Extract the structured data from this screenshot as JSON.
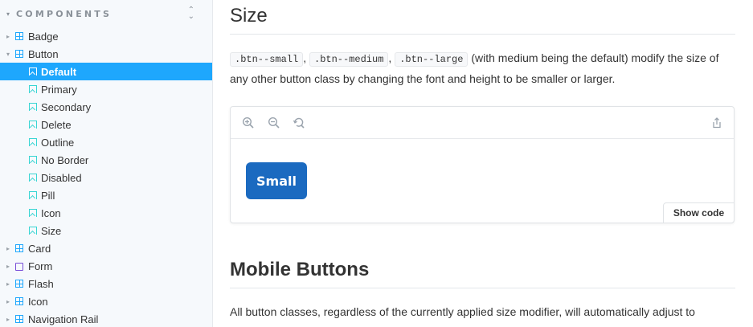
{
  "sidebar": {
    "section_title": "COMPONENTS",
    "items": [
      {
        "label": "Badge",
        "type": "component",
        "expanded": false
      },
      {
        "label": "Button",
        "type": "component",
        "expanded": true
      },
      {
        "label": "Default",
        "type": "story",
        "selected": true
      },
      {
        "label": "Primary",
        "type": "story"
      },
      {
        "label": "Secondary",
        "type": "story"
      },
      {
        "label": "Delete",
        "type": "story"
      },
      {
        "label": "Outline",
        "type": "story"
      },
      {
        "label": "No Border",
        "type": "story"
      },
      {
        "label": "Disabled",
        "type": "story"
      },
      {
        "label": "Pill",
        "type": "story"
      },
      {
        "label": "Icon",
        "type": "story"
      },
      {
        "label": "Size",
        "type": "story"
      },
      {
        "label": "Card",
        "type": "component",
        "expanded": false
      },
      {
        "label": "Form",
        "type": "folder",
        "expanded": false
      },
      {
        "label": "Flash",
        "type": "component",
        "expanded": false
      },
      {
        "label": "Icon",
        "type": "component",
        "expanded": false
      },
      {
        "label": "Navigation Rail",
        "type": "component",
        "expanded": false
      }
    ]
  },
  "main": {
    "size_heading": "Size",
    "size_code_small": ".btn--small",
    "size_code_medium": ".btn--medium",
    "size_code_large": ".btn--large",
    "size_sep": ",",
    "size_text": "(with medium being the default) modify the size of any other button class by changing the font and height to be smaller or larger.",
    "preview": {
      "button_label": "Small",
      "show_code": "Show code"
    },
    "mobile_heading": "Mobile Buttons",
    "mobile_text": "All button classes, regardless of the currently applied size modifier, will automatically adjust to"
  },
  "colors": {
    "selected": "#1ea7fd",
    "button": "#1b6ac0",
    "story_icon": "#37d5d3",
    "folder_icon": "#774dd7"
  }
}
